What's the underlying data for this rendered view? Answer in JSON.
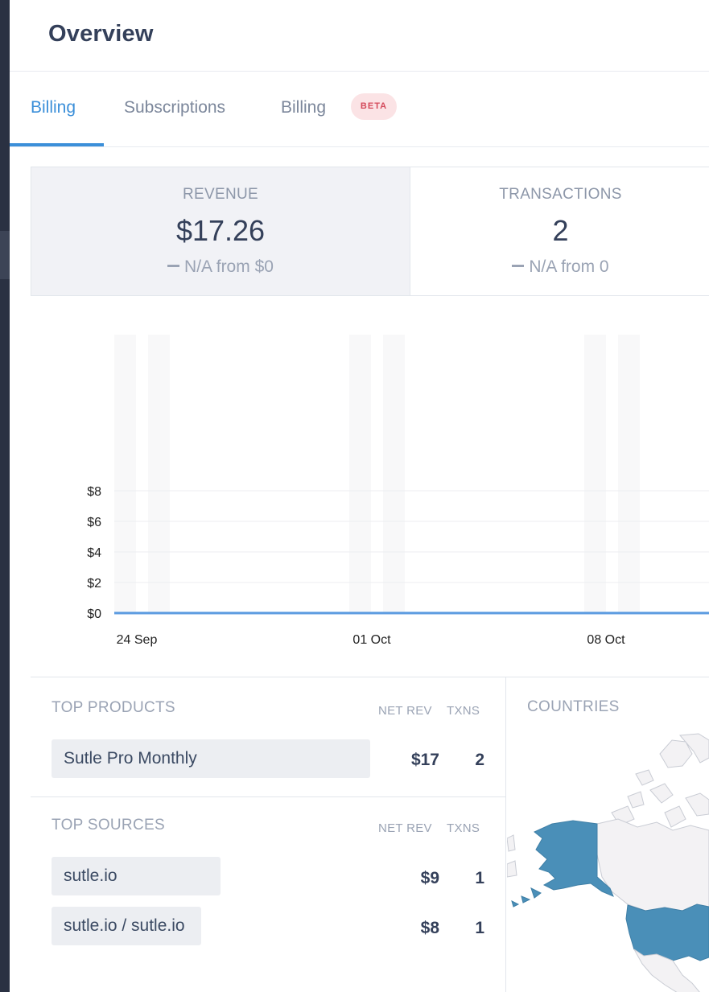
{
  "header": {
    "title": "Overview"
  },
  "tabs": [
    {
      "label": "Billing",
      "active": true
    },
    {
      "label": "Subscriptions",
      "active": false
    },
    {
      "label": "Billing",
      "active": false,
      "badge": "BETA"
    }
  ],
  "stats": {
    "revenue": {
      "label": "REVENUE",
      "value": "$17.26",
      "change": "N/A from $0"
    },
    "transactions": {
      "label": "TRANSACTIONS",
      "value": "2",
      "change": "N/A from 0"
    }
  },
  "chart_data": {
    "type": "line",
    "x": [
      "24 Sep",
      "01 Oct",
      "08 Oct"
    ],
    "x_tick_labels": [
      "24 Sep",
      "01 Oct",
      "08 Oct"
    ],
    "y_tick_labels": [
      "$0",
      "$2",
      "$4",
      "$6",
      "$8"
    ],
    "ylim": [
      0,
      9
    ],
    "grid": true,
    "series": [
      {
        "values": [
          0,
          0,
          0
        ],
        "color": "#5b9be0"
      }
    ]
  },
  "top_products": {
    "title": "TOP PRODUCTS",
    "col_net_rev": "NET REV",
    "col_txns": "TXNS",
    "rows": [
      {
        "name": "Sutle Pro Monthly",
        "net_rev": "$17",
        "txns": "2"
      }
    ]
  },
  "top_sources": {
    "title": "TOP SOURCES",
    "col_net_rev": "NET REV",
    "col_txns": "TXNS",
    "rows": [
      {
        "name": "sutle.io",
        "net_rev": "$9",
        "txns": "1"
      },
      {
        "name": "sutle.io / sutle.io",
        "net_rev": "$8",
        "txns": "1"
      }
    ]
  },
  "countries": {
    "title": "COUNTRIES",
    "highlight_color": "#4a8fb8",
    "base_color": "#f3f2f4"
  },
  "colors": {
    "accent": "#3b8fd9",
    "badge_bg": "#fbe3e5",
    "badge_text": "#d44a5b",
    "sidebar": "#2a3142"
  }
}
